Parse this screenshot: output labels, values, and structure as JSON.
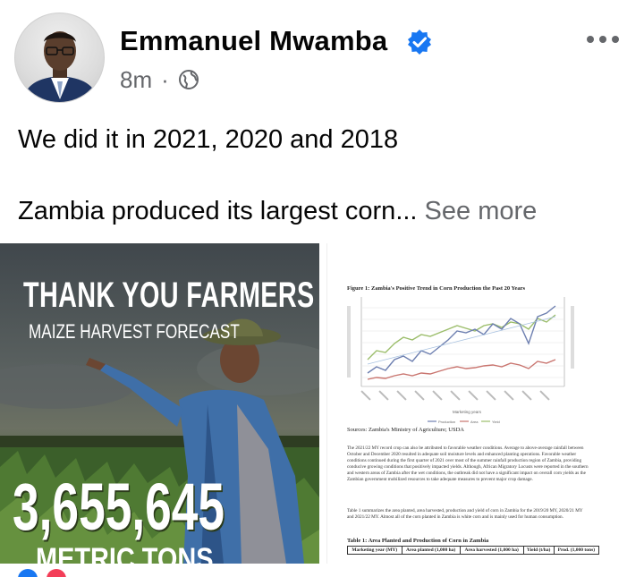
{
  "post": {
    "author": "Emmanuel Mwamba",
    "time": "8m",
    "separator": "·",
    "text_line1": "We did it in 2021, 2020 and 2018",
    "text_line2": "Zambia produced its largest corn...",
    "see_more": "See more"
  },
  "photo_left": {
    "headline": "THANK YOU FARMERS",
    "subheadline": "MAIZE HARVEST FORECAST",
    "number": "3,655,645",
    "unit": "METRIC TONS"
  },
  "photo_right": {
    "figure_title": "Figure 1: Zambia's Positive Trend in Corn Production the Past 20 Years",
    "x_axis_label": "Marketing years",
    "legend": [
      "Production",
      "Area",
      "Yield"
    ],
    "sources": "Sources: Zambia's Ministry of Agriculture; USDA",
    "paragraph1": "The 2021/22 MY record crop can also be attributed to favorable weather conditions. Average to above-average rainfall between October and December 2020 resulted in adequate soil moisture levels and enhanced planting operations. Favorable weather conditions continued during the first quarter of 2021 over most of the summer rainfall production region of Zambia, providing conducive growing conditions that positively impacted yields. Although, African Migratory Locusts were reported in the southern and western areas of Zambia after the wet conditions, the outbreak did not have a significant impact on overall corn yields as the Zambian government mobilized resources to take adequate measures to prevent major crop damage.",
    "paragraph2": "Table 1 summarizes the area planted, area harvested, production and yield of corn in Zambia for the 2019/20 MY, 2020/21 MY and 2021/22 MY. Almost all of the corn planted in Zambia is white corn and is mainly used for human consumption.",
    "table_title": "Table 1: Area Planted and Production of Corn in Zambia",
    "table_headers": [
      "Marketing year (MY)",
      "Area planted (1,000 ha)",
      "Area harvested (1,000 ha)",
      "Yield (t/ha)",
      "Prod. (1,000 tons)"
    ]
  },
  "colors": {
    "verified": "#1877f2",
    "meta_gray": "#65676b",
    "production_line": "#6d7fb0",
    "area_line": "#c9756f",
    "yield_line": "#9bbd6a"
  }
}
